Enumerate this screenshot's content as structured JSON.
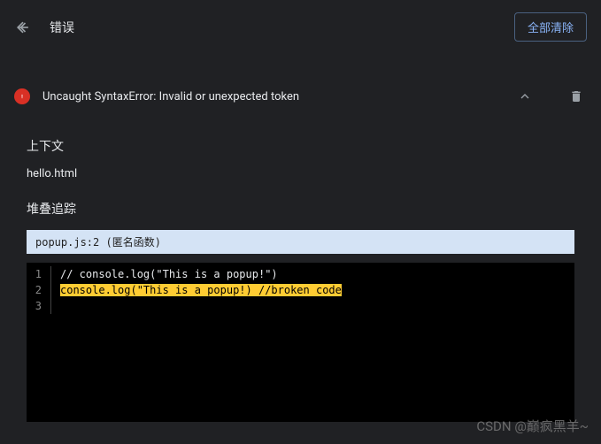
{
  "header": {
    "title": "错误",
    "clear_all": "全部清除"
  },
  "error": {
    "message": "Uncaught SyntaxError: Invalid or unexpected token"
  },
  "context": {
    "label": "上下文",
    "file": "hello.html"
  },
  "stack": {
    "label": "堆叠追踪",
    "location": "popup.js:2 (匿名函数)"
  },
  "code": {
    "lines": [
      {
        "num": "1",
        "text": "// console.log(\"This is a popup!\")",
        "highlight": false
      },
      {
        "num": "2",
        "text": "console.log(\"This is a popup!) //broken code",
        "highlight": true
      },
      {
        "num": "3",
        "text": "",
        "highlight": false
      }
    ]
  },
  "watermark": "CSDN @巅疯黑羊~"
}
